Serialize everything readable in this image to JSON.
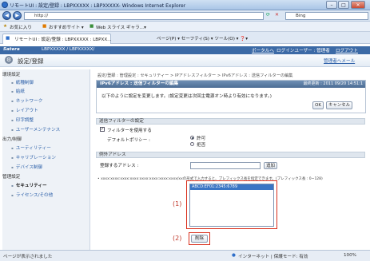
{
  "window": {
    "title": "リモートUI : 設定/登録 : LBPXXXXX : LBPXXXXX- Windows Internet Explorer"
  },
  "address": {
    "url": "http://",
    "search_placeholder": "Bing"
  },
  "favorites": {
    "favorites_label": "お気に入り",
    "suggested_label": "おすすめサイト ▾",
    "web_slice_label": "Web スライス ギャラ...▾",
    "tools": "ページ(P) ▾  セーフティ(S) ▾  ツール(O) ▾  ❓▾"
  },
  "tab": {
    "label": "リモートUI : 設定/登録 : LBPXXXXX : LBPXX..."
  },
  "appbar": {
    "brand": "Satera",
    "device": "LBPXXXXX / LBPXXXXX/",
    "portal": "ポータルへ",
    "login_user": "ログインユーザー : 管理者",
    "logout": "ログアウト"
  },
  "page": {
    "title": "設定/登録",
    "admin_mail": "管理者へメール"
  },
  "sidebar": {
    "group1": "環境設定",
    "items1": [
      "紙種制御",
      "給紙",
      "ネットワーク",
      "レイアウト",
      "印字調整",
      "ユーザーメンテナンス"
    ],
    "group2": "出力/制御",
    "items2": [
      "ユーティリティー",
      "キャリブレーション",
      "デバイス制御"
    ],
    "group3": "管理設定",
    "items3": [
      "セキュリティー",
      "ライセンス/その他"
    ]
  },
  "breadcrumb": "設定/登録 : 管理設定 : セキュリティー > IPアドレスフィルター > IPv6アドレス : 送信フィルターの編集",
  "panel": {
    "title": "IPv6アドレス : 送信フィルターの編集",
    "updated": "最終更新 : 2011 09/20 14:51:1",
    "message": "以下のように設定を変更します。(設定変更は次回主電源オン時より有効になります。)",
    "ok": "OK",
    "cancel": "キャンセル",
    "section1": "送信フィルターの設定",
    "use_filter": "フィルターを使用する",
    "default_policy": "デフォルトポリシー :",
    "permit": "許可",
    "deny": "拒否",
    "section2": "例外アドレス",
    "address_label": "登録するアドレス :",
    "add": "追加",
    "hint": "• xxxx:xxxx:xxxx:xxxx:xxxx:xxxx:xxxx:xxxx/xxの形式で入力すると、プレフィックス長を指定できます。(プレフィックス長 : 0~128)",
    "list_item": "ABCD:EF01:2345:6789",
    "delete": "削除"
  },
  "callouts": {
    "c1": "(1)",
    "c2": "(2)"
  },
  "status": {
    "left": "ページが表示されました",
    "zone": "インターネット | 保護モード: 有効",
    "zoom": "100%"
  },
  "colors": {
    "appbar": "#3c6aa6",
    "panel_header": "#4b6c94",
    "selection": "#3a75c4",
    "callout": "#d9301d"
  }
}
